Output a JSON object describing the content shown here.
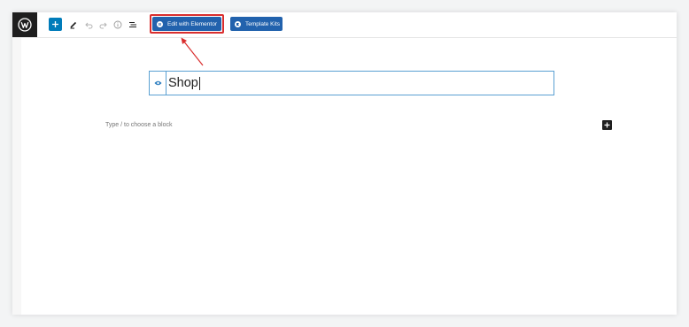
{
  "toolbar": {
    "logo_icon": "wordpress-icon",
    "add_block_icon": "plus-icon",
    "tools_icon": "pencil-icon",
    "undo_icon": "undo-icon",
    "redo_icon": "redo-icon",
    "details_icon": "info-icon",
    "outline_icon": "list-view-icon",
    "edit_with_elementor_label": "Edit with Elementor",
    "template_kits_label": "Template Kits"
  },
  "editor": {
    "post_title": "Shop",
    "title_icon": "eye-icon",
    "block_placeholder": "Type / to choose a block",
    "inserter_icon": "plus-icon"
  },
  "colors": {
    "primary_blue": "#007cba",
    "elementor_blue": "#2262ad",
    "highlight_red": "#d92e2e",
    "dark": "#1e1e1e"
  }
}
